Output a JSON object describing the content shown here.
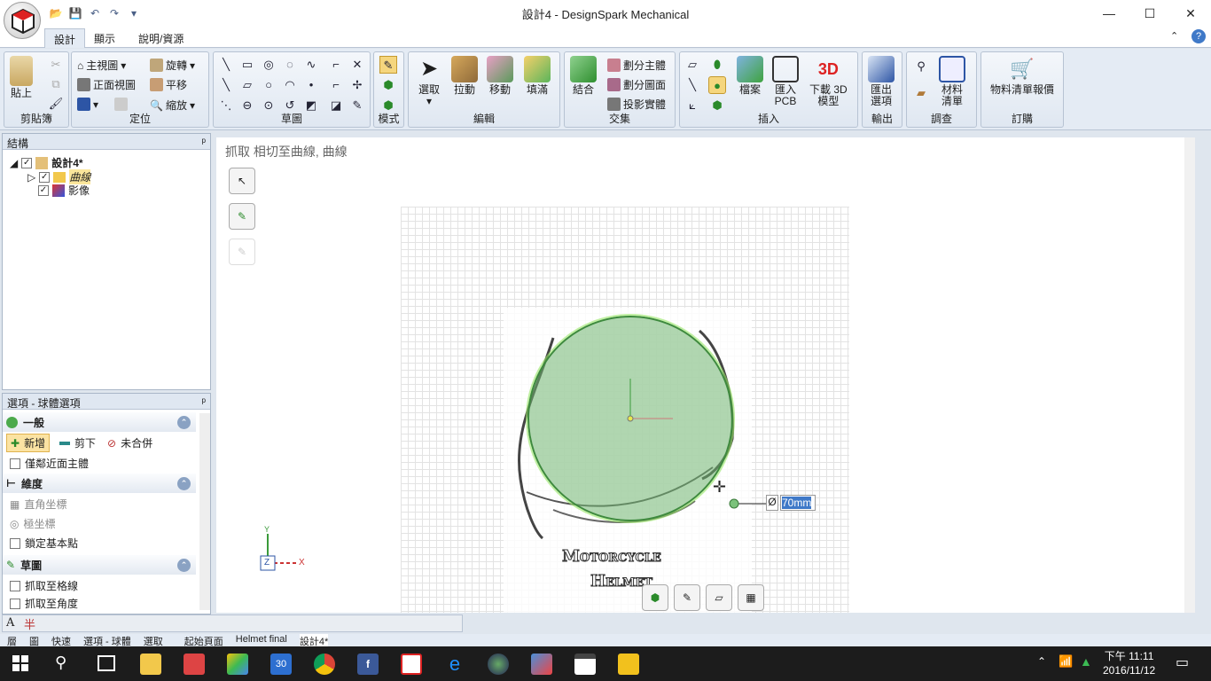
{
  "window": {
    "title": "設計4 - DesignSpark Mechanical",
    "minimize": "—",
    "maximize": "☐",
    "close": "✕"
  },
  "qat": {
    "open": "📂",
    "save": "💾",
    "undo": "↶",
    "redo": "↷",
    "customize": "▾"
  },
  "tabs": [
    "設計",
    "顯示",
    "說明/資源"
  ],
  "ribbon": {
    "clipboard": {
      "label": "剪貼簿",
      "paste": "貼上"
    },
    "orient": {
      "label": "定位",
      "home": "主視圖",
      "front": "正面視圖",
      "rotate": "旋轉",
      "pan": "平移",
      "zoom": "縮放"
    },
    "sketch": {
      "label": "草圖"
    },
    "mode": {
      "label": "模式"
    },
    "edit": {
      "label": "編輯",
      "select": "選取",
      "pull": "拉動",
      "move": "移動",
      "fill": "填滿"
    },
    "intersect": {
      "label": "交集",
      "combine": "結合",
      "split_body": "劃分主體",
      "split_face": "劃分圖面",
      "project": "投影實體"
    },
    "insert": {
      "label": "插入",
      "file": "檔案",
      "import_pcb": "匯入\nPCB",
      "download_3d": "下載 3D\n模型"
    },
    "output": {
      "label": "輸出",
      "export": "匯出\n選項"
    },
    "inspect": {
      "label": "調查",
      "bom": "材料\n清單"
    },
    "order": {
      "label": "訂購",
      "bom_quote": "物料清單報價"
    }
  },
  "structure": {
    "header": "結構",
    "pin": "ᵖ",
    "root": "設計4*",
    "items": [
      "曲線",
      "影像"
    ]
  },
  "options": {
    "header": "選項 - 球體選項",
    "general": {
      "title": "一般",
      "add": "新增",
      "cut": "剪下",
      "no_merge": "未合併",
      "nearby_only": "僅鄰近面主體"
    },
    "dimension": {
      "title": "維度",
      "cartesian": "直角坐標",
      "polar": "極坐標",
      "lock_base": "鎖定基本點"
    },
    "sketch": {
      "title": "草圖",
      "snap_grid": "抓取至格線",
      "snap_angle": "抓取至角度"
    }
  },
  "canvas": {
    "status_text": "抓取 相切至曲線, 曲線",
    "dimension_symbol": "Ø",
    "dimension_value": "70mm",
    "helmet_text_1": "Motorcycle",
    "helmet_text_2": "Helmet",
    "axis_x": "X",
    "axis_y": "Y",
    "axis_z": "Z"
  },
  "bottom_tabs": [
    "層",
    "圖",
    "快速",
    "選項 - 球體",
    "選取"
  ],
  "doc_tabs": [
    "起始頁面",
    "Helmet final",
    "設計4*"
  ],
  "taskbar": {
    "time": "下午 11:11",
    "date": "2016/11/12",
    "calendar_day": "30",
    "notification_icon": "▭"
  },
  "colors": {
    "accent": "#3f79c8",
    "sphere": "#6fb56f",
    "taskbar": "#1c1c1c"
  }
}
